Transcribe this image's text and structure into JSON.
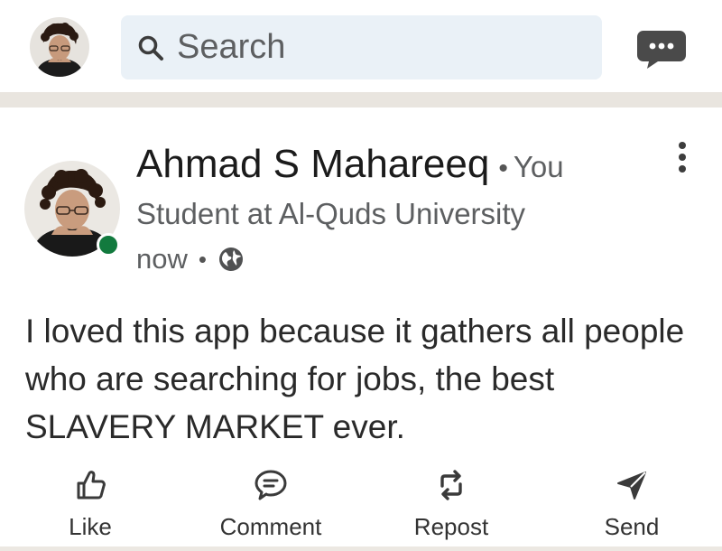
{
  "topbar": {
    "profile_avatar": "user-avatar-photo",
    "search_placeholder": "Search",
    "search_icon": "search-icon",
    "messaging_icon": "messaging-icon"
  },
  "post": {
    "author": {
      "name": "Ahmad S Mahareeq",
      "separator": "•",
      "relation": "You",
      "headline": "Student at Al-Quds University",
      "online": true
    },
    "meta": {
      "time": "now",
      "separator": "•",
      "visibility_icon": "globe-icon"
    },
    "more_icon": "more-vertical-icon",
    "body": "I loved this app because it gathers all people who are searching for jobs, the best SLAVERY MARKET ever."
  },
  "actions": [
    {
      "label": "Like",
      "icon": "thumbs-up-icon"
    },
    {
      "label": "Comment",
      "icon": "comment-icon"
    },
    {
      "label": "Repost",
      "icon": "repost-icon"
    },
    {
      "label": "Send",
      "icon": "send-icon"
    }
  ],
  "colors": {
    "search_bg": "#eaf1f7",
    "divider": "#e9e5df",
    "online": "#127a3e",
    "text_secondary": "#5d5f61"
  }
}
